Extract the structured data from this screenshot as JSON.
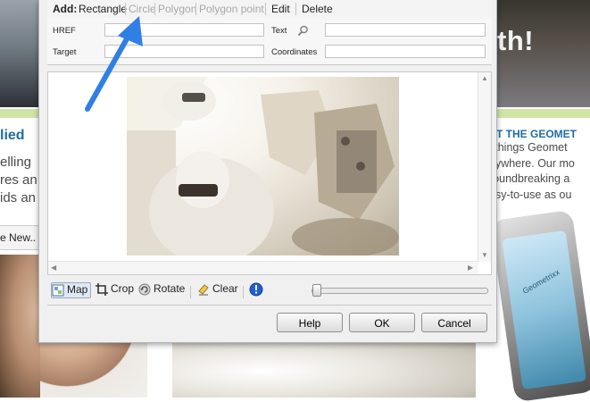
{
  "background": {
    "header_title": "th!",
    "heading_left": "lied",
    "text_left": "elling\nres an\nids an",
    "nav": "e  New..",
    "heading_right": "ET THE GEOMET",
    "text_right": "l things Geomet\nnywhere. Our mo\nroundbreaking a\nasy-to-use as ou",
    "phone_text": "Geometrixx"
  },
  "toolbar": {
    "add_label": "Add:",
    "rectangle": "Rectangle",
    "circle": "Circle",
    "polygon": "Polygon",
    "polygon_point": "Polygon point",
    "edit": "Edit",
    "delete": "Delete"
  },
  "form": {
    "href_label": "HREF",
    "href_value": "",
    "text_label": "Text",
    "text_value": "",
    "target_label": "Target",
    "target_value": "",
    "coordinates_label": "Coordinates",
    "coordinates_value": ""
  },
  "tools": {
    "map": "Map",
    "crop": "Crop",
    "rotate": "Rotate",
    "clear": "Clear"
  },
  "slider": {
    "level": 0.0
  },
  "buttons": {
    "help": "Help",
    "ok": "OK",
    "cancel": "Cancel"
  },
  "colors": {
    "accent_blue": "#2f7fe6",
    "heading_blue": "#1f6da5",
    "stripe_green": "#cfe5a5"
  }
}
